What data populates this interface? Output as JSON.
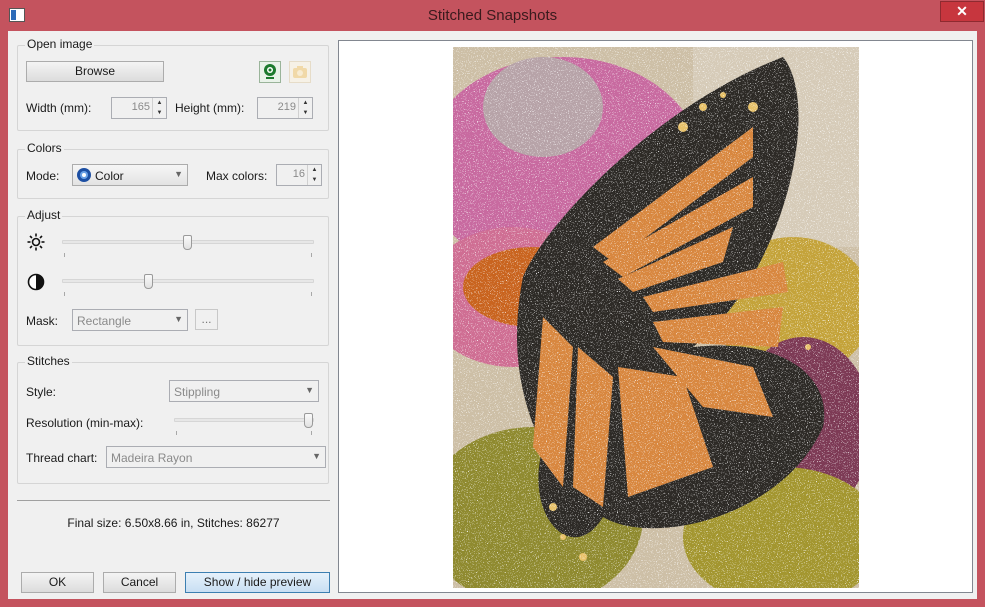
{
  "window": {
    "title": "Stitched Snapshots",
    "close_glyph": "✕"
  },
  "open_image": {
    "title": "Open image",
    "browse_label": "Browse",
    "width_label": "Width (mm):",
    "width_value": "165",
    "height_label": "Height (mm):",
    "height_value": "219"
  },
  "colors": {
    "title": "Colors",
    "mode_label": "Mode:",
    "mode_value": "Color",
    "max_colors_label": "Max colors:",
    "max_colors_value": "16"
  },
  "adjust": {
    "title": "Adjust",
    "brightness_level": 0.5,
    "contrast_level": 0.34,
    "mask_label": "Mask:",
    "mask_value": "Rectangle",
    "mask_button_label": "..."
  },
  "stitches": {
    "title": "Stitches",
    "style_label": "Style:",
    "style_value": "Stippling",
    "resolution_label": "Resolution (min-max):",
    "resolution_level": 1.0,
    "thread_chart_label": "Thread chart:",
    "thread_chart_value": "Madeira Rayon"
  },
  "summary": {
    "text": "Final size: 6.50x8.66 in, Stitches: 86277"
  },
  "footer": {
    "ok_label": "OK",
    "cancel_label": "Cancel",
    "preview_label": "Show / hide preview"
  },
  "colors_palette": {
    "accent": "#3c7fb1",
    "title_bar": "#c4535e",
    "close": "#c7363e"
  }
}
